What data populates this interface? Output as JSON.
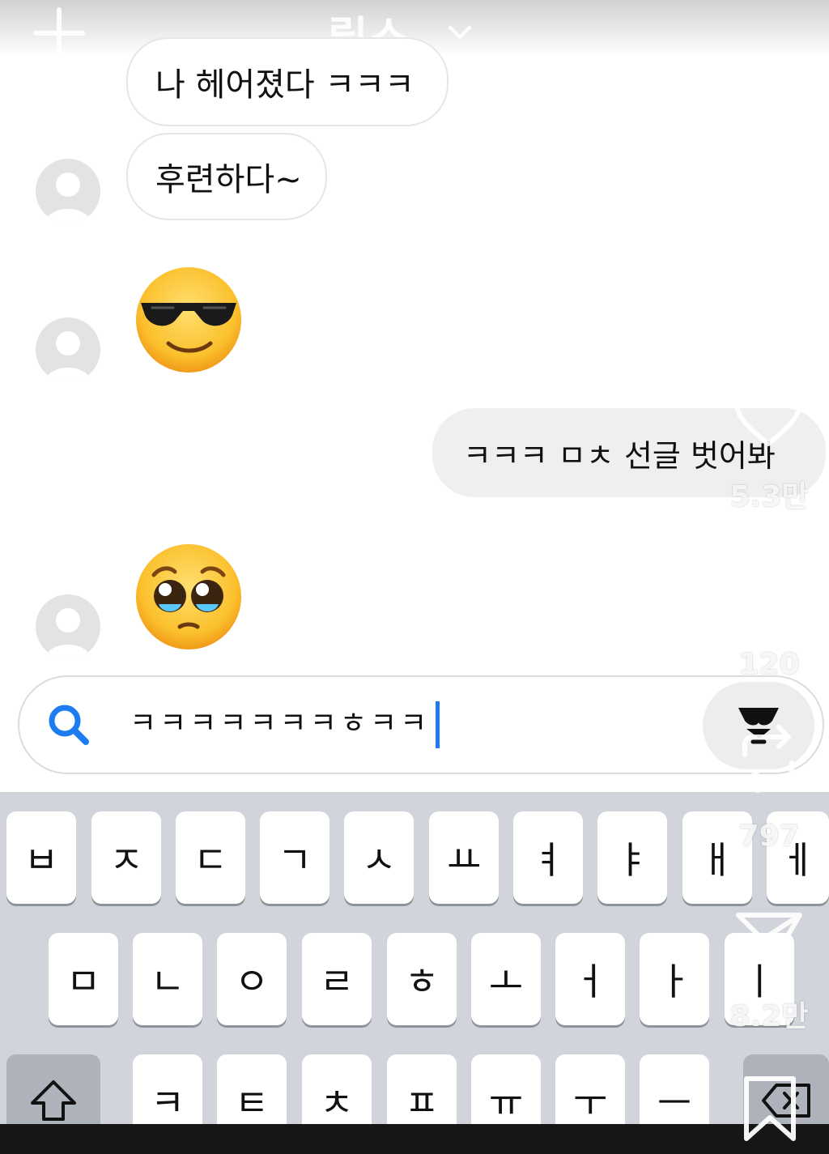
{
  "header": {
    "title": "릴스"
  },
  "chat": {
    "messages": [
      {
        "text": "나 헤어졌다 ㅋㅋㅋ"
      },
      {
        "text": "후련하다~"
      },
      {
        "text": "ㅋㅋㅋ ㅁㅊ 선글 벗어봐"
      }
    ],
    "emojis": [
      "sunglasses-face",
      "pleading-face"
    ]
  },
  "search": {
    "value": "ㅋㅋㅋㅋㅋㅋㅋㅎㅋㅋ",
    "accent": "#1e7cf2"
  },
  "keyboard": {
    "row1": [
      "ㅂ",
      "ㅈ",
      "ㄷ",
      "ㄱ",
      "ㅅ",
      "ㅛ",
      "ㅕ",
      "ㅑ",
      "ㅐ",
      "ㅔ"
    ],
    "row2": [
      "ㅁ",
      "ㄴ",
      "ㅇ",
      "ㄹ",
      "ㅎ",
      "ㅗ",
      "ㅓ",
      "ㅏ",
      "ㅣ"
    ],
    "row3": [
      "ㅋ",
      "ㅌ",
      "ㅊ",
      "ㅍ",
      "ㅠ",
      "ㅜ",
      "ㅡ"
    ]
  },
  "reels_actions": {
    "likes": "5.3만",
    "comments": "120",
    "reposts": "797",
    "shares": "8.2만"
  }
}
